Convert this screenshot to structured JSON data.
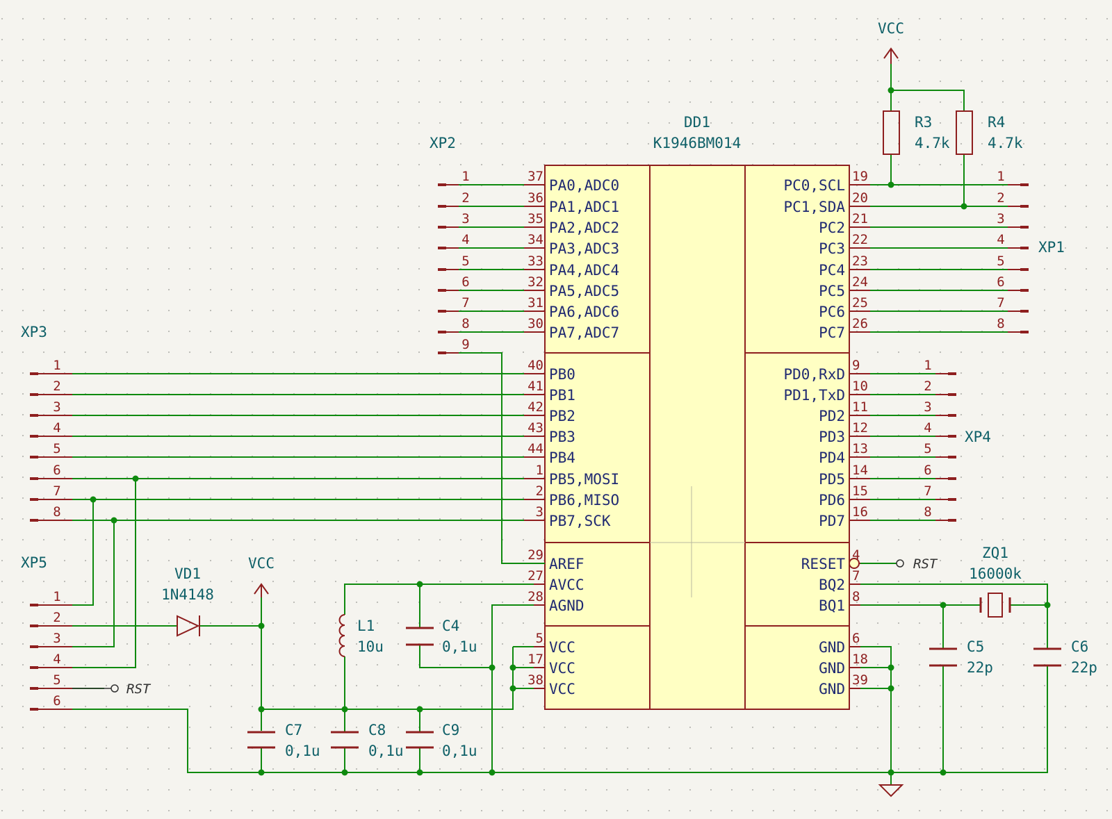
{
  "components": {
    "DD1": {
      "ref": "DD1",
      "value": "K1946BM014"
    },
    "R3": {
      "ref": "R3",
      "value": "4.7k"
    },
    "R4": {
      "ref": "R4",
      "value": "4.7k"
    },
    "VD1": {
      "ref": "VD1",
      "value": "1N4148"
    },
    "L1": {
      "ref": "L1",
      "value": "10u"
    },
    "C4": {
      "ref": "C4",
      "value": "0,1u"
    },
    "C5": {
      "ref": "C5",
      "value": "22p"
    },
    "C6": {
      "ref": "C6",
      "value": "22p"
    },
    "C7": {
      "ref": "C7",
      "value": "0,1u"
    },
    "C8": {
      "ref": "C8",
      "value": "0,1u"
    },
    "C9": {
      "ref": "C9",
      "value": "0,1u"
    },
    "ZQ1": {
      "ref": "ZQ1",
      "value": "16000k"
    }
  },
  "connectors": {
    "XP1": "XP1",
    "XP2": "XP2",
    "XP3": "XP3",
    "XP4": "XP4",
    "XP5": "XP5"
  },
  "power": {
    "vcc": "VCC"
  },
  "net_labels": {
    "rst": "RST"
  },
  "dd1_left_pins": [
    {
      "num": "37",
      "name": "PA0,ADC0"
    },
    {
      "num": "36",
      "name": "PA1,ADC1"
    },
    {
      "num": "35",
      "name": "PA2,ADC2"
    },
    {
      "num": "34",
      "name": "PA3,ADC3"
    },
    {
      "num": "33",
      "name": "PA4,ADC4"
    },
    {
      "num": "32",
      "name": "PA5,ADC5"
    },
    {
      "num": "31",
      "name": "PA6,ADC6"
    },
    {
      "num": "30",
      "name": "PA7,ADC7"
    },
    {
      "num": "40",
      "name": "PB0"
    },
    {
      "num": "41",
      "name": "PB1"
    },
    {
      "num": "42",
      "name": "PB2"
    },
    {
      "num": "43",
      "name": "PB3"
    },
    {
      "num": "44",
      "name": "PB4"
    },
    {
      "num": "1",
      "name": "PB5,MOSI"
    },
    {
      "num": "2",
      "name": "PB6,MISO"
    },
    {
      "num": "3",
      "name": "PB7,SCK"
    },
    {
      "num": "29",
      "name": "AREF"
    },
    {
      "num": "27",
      "name": "AVCC"
    },
    {
      "num": "28",
      "name": "AGND"
    },
    {
      "num": "5",
      "name": "VCC"
    },
    {
      "num": "17",
      "name": "VCC"
    },
    {
      "num": "38",
      "name": "VCC"
    }
  ],
  "dd1_right_pins": [
    {
      "num": "19",
      "name": "PC0,SCL"
    },
    {
      "num": "20",
      "name": "PC1,SDA"
    },
    {
      "num": "21",
      "name": "PC2"
    },
    {
      "num": "22",
      "name": "PC3"
    },
    {
      "num": "23",
      "name": "PC4"
    },
    {
      "num": "24",
      "name": "PC5"
    },
    {
      "num": "25",
      "name": "PC6"
    },
    {
      "num": "26",
      "name": "PC7"
    },
    {
      "num": "9",
      "name": "PD0,RxD"
    },
    {
      "num": "10",
      "name": "PD1,TxD"
    },
    {
      "num": "11",
      "name": "PD2"
    },
    {
      "num": "12",
      "name": "PD3"
    },
    {
      "num": "13",
      "name": "PD4"
    },
    {
      "num": "14",
      "name": "PD5"
    },
    {
      "num": "15",
      "name": "PD6"
    },
    {
      "num": "16",
      "name": "PD7"
    },
    {
      "num": "4",
      "name": "RESET"
    },
    {
      "num": "7",
      "name": "BQ2"
    },
    {
      "num": "8",
      "name": "BQ1"
    },
    {
      "num": "6",
      "name": "GND"
    },
    {
      "num": "18",
      "name": "GND"
    },
    {
      "num": "39",
      "name": "GND"
    }
  ],
  "xp1_pins": [
    "1",
    "2",
    "3",
    "4",
    "5",
    "6",
    "7",
    "8"
  ],
  "xp2_pins": [
    "1",
    "2",
    "3",
    "4",
    "5",
    "6",
    "7",
    "8",
    "9"
  ],
  "xp3_pins": [
    "1",
    "2",
    "3",
    "4",
    "5",
    "6",
    "7",
    "8"
  ],
  "xp4_pins": [
    "1",
    "2",
    "3",
    "4",
    "5",
    "6",
    "7",
    "8"
  ],
  "xp5_pins": [
    "1",
    "2",
    "3",
    "4",
    "5",
    "6"
  ]
}
